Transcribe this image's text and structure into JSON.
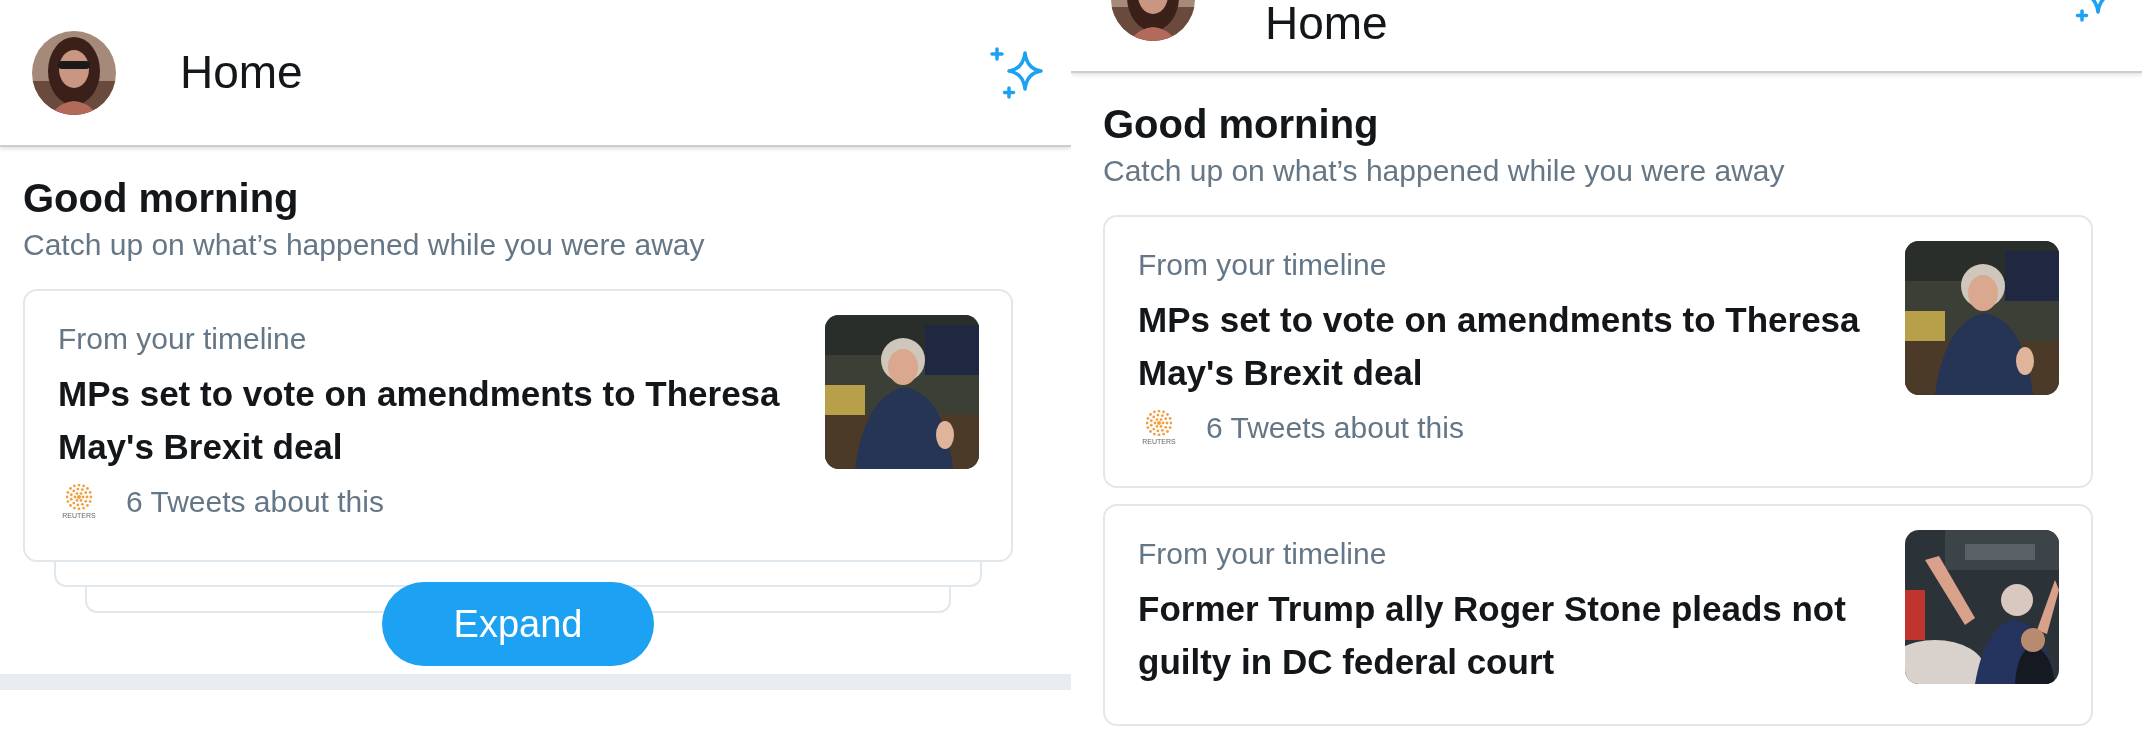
{
  "panels": [
    {
      "header": {
        "title": "Home"
      },
      "greeting": {
        "title": "Good morning",
        "subtitle": "Catch up on what’s happened while you were away"
      },
      "stories": [
        {
          "label": "From your timeline",
          "headline": "MPs set to vote on amendments to Theresa May's Brexit deal",
          "source_label": "REUTERS",
          "tweets": "6 Tweets about this"
        }
      ],
      "expand_button": "Expand"
    },
    {
      "header": {
        "title": "Home"
      },
      "greeting": {
        "title": "Good morning",
        "subtitle": "Catch up on what’s happened while you were away"
      },
      "stories": [
        {
          "label": "From your timeline",
          "headline": "MPs set to vote on amendments to Theresa May's Brexit deal",
          "source_label": "REUTERS",
          "tweets": "6 Tweets about this"
        },
        {
          "label": "From your timeline",
          "headline": "Former Trump ally Roger Stone pleads not guilty in DC federal court"
        }
      ]
    }
  ]
}
